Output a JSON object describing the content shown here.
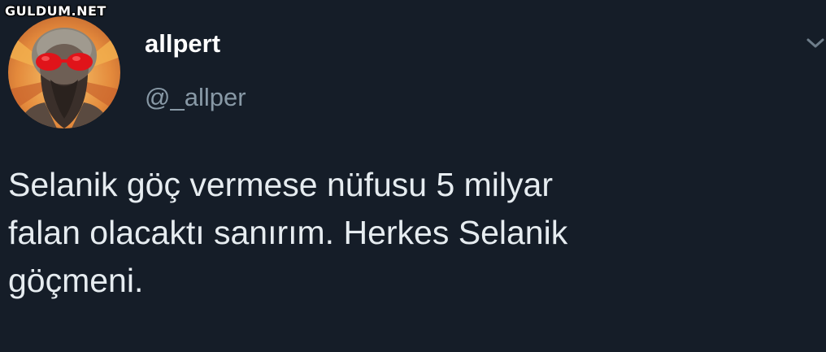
{
  "watermark": "GULDUM.NET",
  "tweet": {
    "author": {
      "display_name": "allpert",
      "handle": "@_allper",
      "avatar_icon": "avatar-bearded-man-red-sunglasses"
    },
    "menu_icon": "chevron-down-icon",
    "text": "Selanik göç vermese nüfusu 5 milyar\nfalan olacaktı sanırım. Herkes Selanik\ngöçmeni."
  },
  "colors": {
    "background": "#151d28",
    "text": "#e6ecf0",
    "secondary_text": "#8899a6"
  }
}
